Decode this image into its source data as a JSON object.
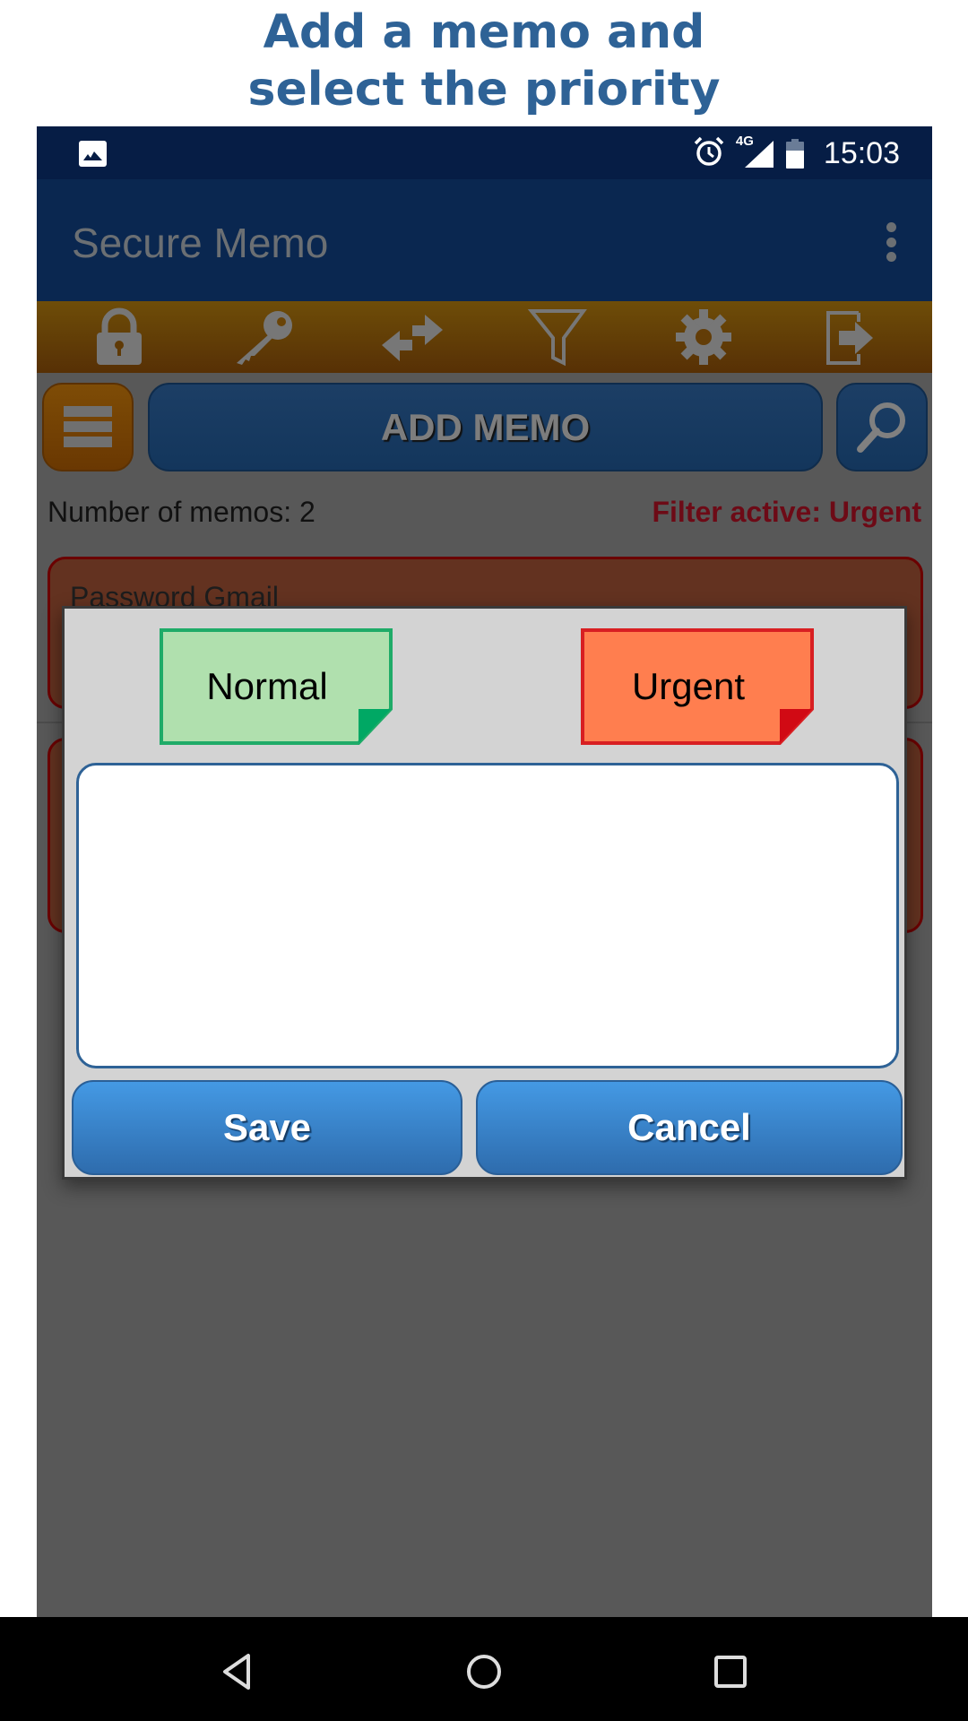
{
  "promo": {
    "line1": "Add a memo and",
    "line2": "select the priority"
  },
  "status_bar": {
    "notification_icon": "gallery-icon",
    "icons": [
      "alarm-icon",
      "signal-4g-icon",
      "battery-icon"
    ],
    "network_label": "4G",
    "time": "15:03"
  },
  "app_bar": {
    "title": "Secure Memo",
    "menu_icon": "overflow-menu-icon"
  },
  "toolbar": {
    "items": [
      {
        "name": "lock",
        "icon": "lock-icon"
      },
      {
        "name": "key",
        "icon": "key-icon"
      },
      {
        "name": "sync",
        "icon": "swap-arrows-icon"
      },
      {
        "name": "filter",
        "icon": "filter-icon"
      },
      {
        "name": "settings",
        "icon": "gear-icon"
      },
      {
        "name": "exit",
        "icon": "exit-icon"
      }
    ]
  },
  "actions": {
    "menu_icon": "hamburger-icon",
    "add_memo_label": "ADD MEMO",
    "search_icon": "search-icon"
  },
  "list_info": {
    "memo_count": "Number of memos: 2",
    "filter_status": "Filter active: Urgent"
  },
  "memos": [
    {
      "title": "Password Gmail",
      "priority": "Urgent"
    },
    {
      "title": "",
      "priority": "Urgent"
    }
  ],
  "dialog": {
    "priorities": [
      {
        "label": "Normal",
        "fill": "#b0e0ae",
        "border": "#1fab68",
        "fold": "#00a864"
      },
      {
        "label": "Urgent",
        "fill": "#ff7e4f",
        "border": "#d81f22",
        "fold": "#d10a14"
      }
    ],
    "memo_text": "",
    "save_label": "Save",
    "cancel_label": "Cancel"
  },
  "colors": {
    "promo_text": "#2e6296",
    "status_bar": "#061d45",
    "app_bar": "#0a2750",
    "toolbar": "#6e4d08",
    "filter_text": "#6d0a16",
    "button_blue": "#3d8bd8"
  },
  "nav_bar": {
    "buttons": [
      "back-icon",
      "home-icon",
      "recents-icon"
    ]
  }
}
